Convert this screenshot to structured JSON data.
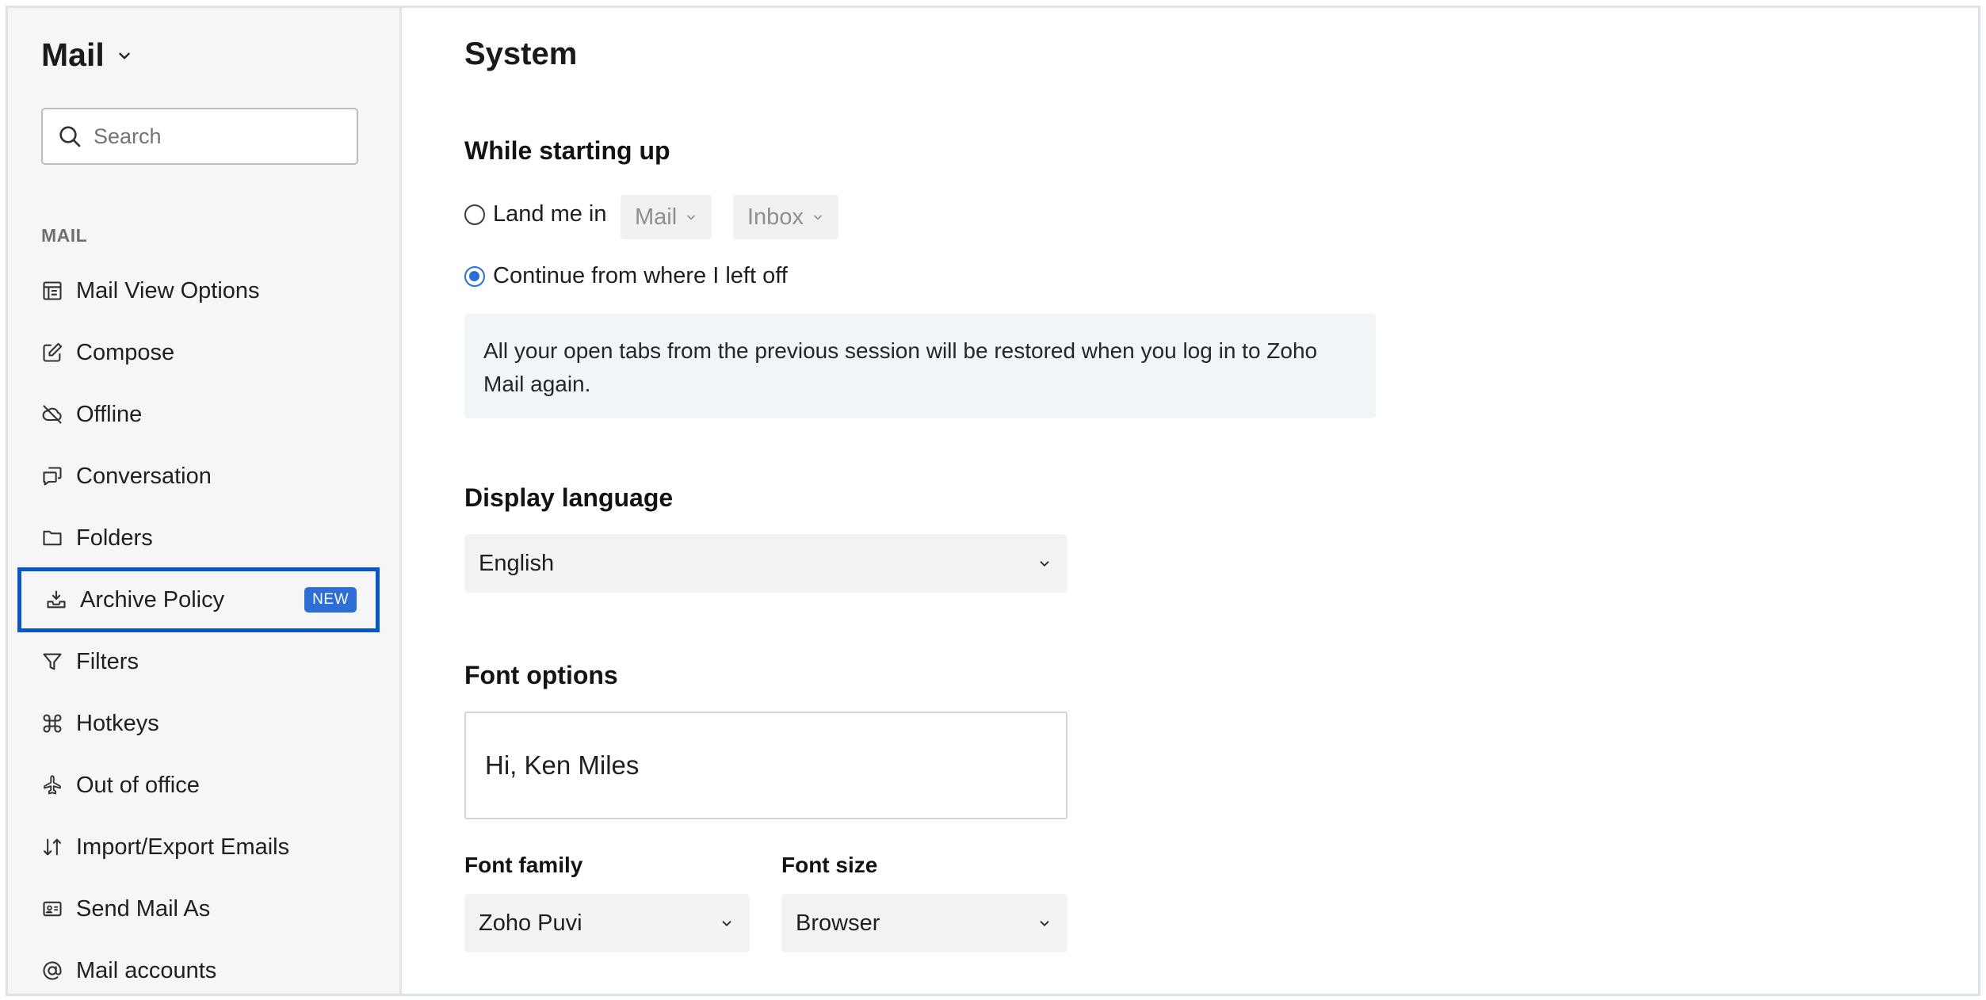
{
  "sidebar": {
    "app_title": "Mail",
    "search_placeholder": "Search",
    "section_label": "MAIL",
    "items": [
      {
        "label": "Mail View Options",
        "icon": "layout-icon"
      },
      {
        "label": "Compose",
        "icon": "edit-icon"
      },
      {
        "label": "Offline",
        "icon": "cloud-off-icon"
      },
      {
        "label": "Conversation",
        "icon": "chat-icon"
      },
      {
        "label": "Folders",
        "icon": "folder-icon"
      },
      {
        "label": "Archive Policy",
        "icon": "archive-icon",
        "badge": "NEW",
        "selected": true
      },
      {
        "label": "Filters",
        "icon": "filter-icon"
      },
      {
        "label": "Hotkeys",
        "icon": "command-icon"
      },
      {
        "label": "Out of office",
        "icon": "plane-icon"
      },
      {
        "label": "Import/Export Emails",
        "icon": "import-export-icon"
      },
      {
        "label": "Send Mail As",
        "icon": "id-card-icon"
      },
      {
        "label": "Mail accounts",
        "icon": "at-icon"
      }
    ]
  },
  "main": {
    "title": "System",
    "startup": {
      "heading": "While starting up",
      "land_label": "Land me in",
      "land_app": "Mail",
      "land_folder": "Inbox",
      "continue_label": "Continue from where I left off",
      "selected": "continue",
      "info": "All your open tabs from the previous session will be restored when you log in to Zoho Mail again."
    },
    "language": {
      "heading": "Display language",
      "value": "English"
    },
    "fonts": {
      "heading": "Font options",
      "preview": "Hi, Ken Miles",
      "family_label": "Font family",
      "family_value": "Zoho Puvi",
      "size_label": "Font size",
      "size_value": "Browser"
    }
  },
  "colors": {
    "accent": "#2c6ed6",
    "selection_border": "#0b57c2",
    "sidebar_bg": "#f6f6f6"
  }
}
